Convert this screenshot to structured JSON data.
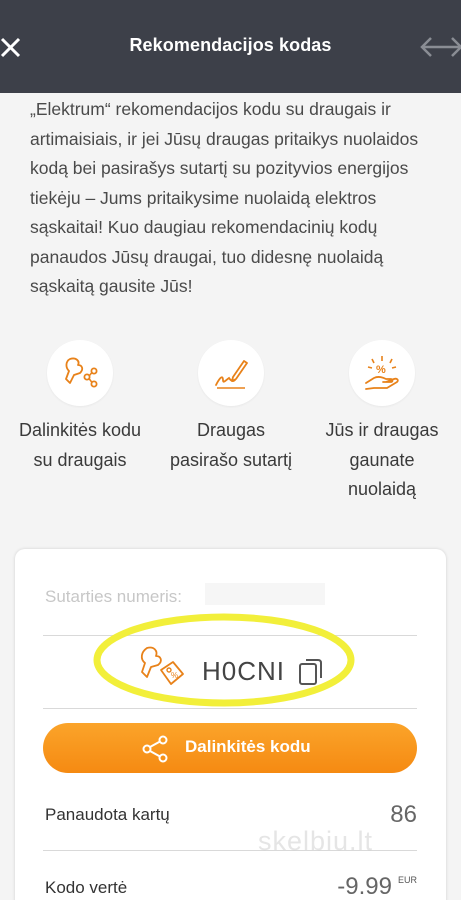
{
  "header": {
    "title": "Rekomendacijos kodas",
    "close_icon": "close-icon",
    "swap_icon": "swap-arrows-icon"
  },
  "intro": {
    "text": "„Elektrum“ rekomendacijos kodu su draugais ir artimaisiais, ir jei Jūsų draugas pritaikys nuolaidos kodą bei pasirašys sutartį su pozityvios energijos tiekėju – Jums pritaikysime nuolaidą elektros sąskaitai! Kuo daugiau rekomendacinių kodų panaudos Jūsų draugai, tuo didesnę nuolaidą sąskaitą gausite Jūs!"
  },
  "steps": [
    {
      "icon": "share-people-icon",
      "label": "Dalinkitės kodu su draugais"
    },
    {
      "icon": "sign-pen-icon",
      "label": "Draugas pasirašo sutartį"
    },
    {
      "icon": "discount-hand-icon",
      "label": "Jūs ir draugas gaunate nuolaidą"
    }
  ],
  "card": {
    "contract_label": "Sutarties numeris:",
    "code": "H0CNI",
    "share_button": "Dalinkitės kodu",
    "stats": {
      "used_label": "Panaudota kartų",
      "used_value": "86",
      "value_label": "Kodo vertė",
      "value_amount": "-9.99",
      "currency": "EUR"
    }
  },
  "watermark": "skelbiu.lt",
  "colors": {
    "header_bg": "#3d4049",
    "accent_orange": "#f7941d",
    "highlight_yellow": "#f2ef3a",
    "background": "#f4f4f4"
  }
}
